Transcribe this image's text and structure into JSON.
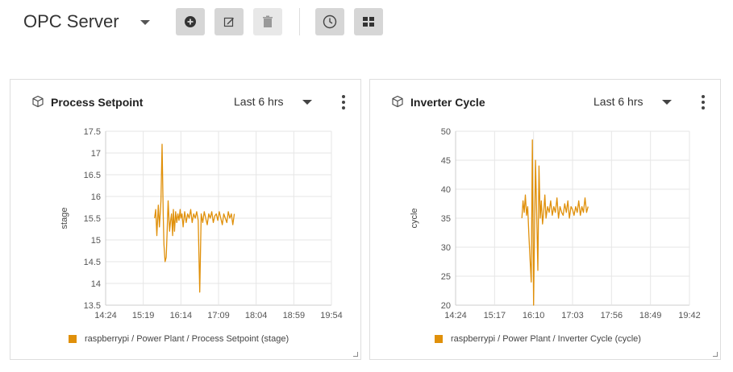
{
  "dashboard": {
    "title": "OPC Server"
  },
  "toolbar": {
    "buttons": [
      {
        "icon": "add-circle-icon",
        "disabled": false
      },
      {
        "icon": "edit-icon",
        "disabled": false
      },
      {
        "icon": "trash-icon",
        "disabled": true
      },
      {
        "icon": "clock-icon",
        "disabled": false
      },
      {
        "icon": "grid-icon",
        "disabled": false
      }
    ]
  },
  "colors": {
    "series": "#e0900a",
    "grid": "#e6e6e6",
    "axis": "#cccccc"
  },
  "panels": [
    {
      "title": "Process Setpoint",
      "time_range": "Last 6 hrs",
      "legend": "raspberrypi / Power Plant / Process Setpoint (stage)",
      "chart_data": {
        "type": "line",
        "ylabel": "stage",
        "ylim": [
          13.5,
          17.5
        ],
        "yticks": [
          "17.5",
          "17",
          "16.5",
          "16",
          "15.5",
          "15",
          "14.5",
          "14",
          "13.5"
        ],
        "xticks": [
          "14:24",
          "15:19",
          "16:14",
          "17:09",
          "18:04",
          "18:59",
          "19:54"
        ],
        "xlim": [
          0,
          6
        ],
        "grid": true,
        "series": [
          {
            "name": "raspberrypi / Power Plant / Process Setpoint (stage)",
            "x": [
              1.3,
              1.33,
              1.36,
              1.4,
              1.43,
              1.47,
              1.5,
              1.53,
              1.55,
              1.58,
              1.61,
              1.63,
              1.66,
              1.7,
              1.72,
              1.75,
              1.78,
              1.8,
              1.83,
              1.86,
              1.89,
              1.92,
              1.95,
              1.98,
              2.0,
              2.03,
              2.06,
              2.1,
              2.14,
              2.18,
              2.22,
              2.26,
              2.3,
              2.34,
              2.38,
              2.42,
              2.46,
              2.5,
              2.54,
              2.58,
              2.62,
              2.66,
              2.7,
              2.74,
              2.78,
              2.82,
              2.86,
              2.9,
              2.94,
              2.98,
              3.02,
              3.06,
              3.1,
              3.14,
              3.18,
              3.22,
              3.26,
              3.3,
              3.34,
              3.38,
              3.42
            ],
            "values": [
              15.5,
              15.7,
              15.1,
              15.8,
              15.3,
              15.9,
              17.2,
              15.6,
              14.9,
              14.5,
              14.6,
              15.1,
              15.9,
              15.2,
              15.4,
              15.6,
              15.1,
              15.7,
              15.2,
              15.65,
              15.4,
              15.6,
              15.45,
              15.7,
              15.5,
              15.6,
              15.3,
              15.65,
              15.4,
              15.6,
              15.5,
              15.7,
              15.4,
              15.6,
              15.5,
              15.65,
              15.45,
              13.8,
              15.6,
              15.4,
              15.65,
              15.5,
              15.35,
              15.6,
              15.5,
              15.65,
              15.4,
              15.55,
              15.6,
              15.45,
              15.65,
              15.5,
              15.35,
              15.6,
              15.5,
              15.4,
              15.65,
              15.5,
              15.6,
              15.35,
              15.6
            ]
          }
        ]
      }
    },
    {
      "title": "Inverter Cycle",
      "time_range": "Last 6 hrs",
      "legend": "raspberrypi / Power Plant / Inverter Cycle (cycle)",
      "chart_data": {
        "type": "line",
        "ylabel": "cycle",
        "ylim": [
          20,
          50
        ],
        "yticks": [
          "50",
          "45",
          "40",
          "35",
          "30",
          "25",
          "20"
        ],
        "xticks": [
          "14:24",
          "15:17",
          "16:10",
          "17:03",
          "17:56",
          "18:49",
          "19:42"
        ],
        "xlim": [
          0,
          6
        ],
        "grid": true,
        "series": [
          {
            "name": "raspberrypi / Power Plant / Inverter Cycle (cycle)",
            "x": [
              1.7,
              1.73,
              1.76,
              1.79,
              1.82,
              1.85,
              1.88,
              1.91,
              1.94,
              1.97,
              2.0,
              2.02,
              2.05,
              2.08,
              2.11,
              2.14,
              2.17,
              2.2,
              2.23,
              2.26,
              2.29,
              2.32,
              2.36,
              2.4,
              2.44,
              2.48,
              2.52,
              2.56,
              2.6,
              2.64,
              2.68,
              2.72,
              2.76,
              2.8,
              2.84,
              2.88,
              2.92,
              2.96,
              3.0,
              3.04,
              3.08,
              3.12,
              3.16,
              3.2,
              3.24,
              3.28,
              3.32,
              3.36,
              3.4
            ],
            "values": [
              35,
              38,
              36,
              39,
              35.5,
              37,
              32,
              28,
              24,
              48.5,
              20,
              30,
              45,
              36,
              26,
              44,
              35,
              38,
              34,
              36,
              39,
              35,
              37,
              36,
              38,
              35.5,
              37,
              36,
              38.5,
              35,
              37,
              36,
              35.5,
              37.5,
              36,
              38,
              35,
              37,
              36.5,
              35.5,
              37,
              36,
              38,
              35.5,
              37,
              36,
              38.5,
              36,
              37
            ]
          }
        ]
      }
    }
  ]
}
